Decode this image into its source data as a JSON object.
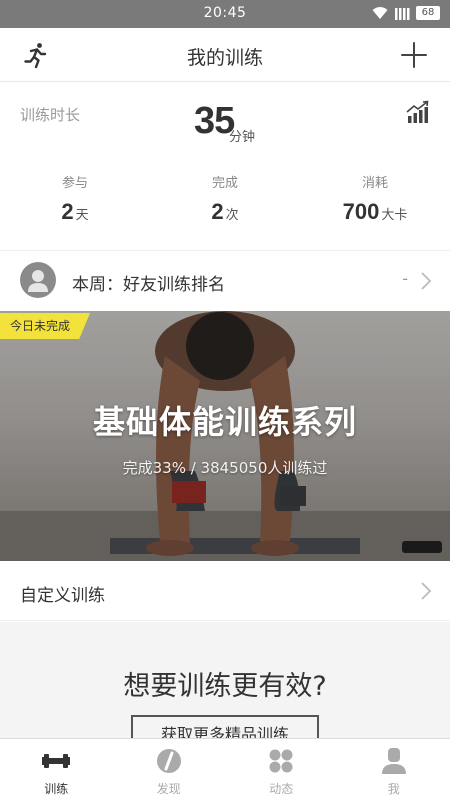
{
  "status_bar": {
    "time": "20:45",
    "battery": "68"
  },
  "header": {
    "title": "我的训练",
    "left_icon": "run-icon",
    "right_icon": "plus-icon"
  },
  "summary": {
    "duration_label": "训练时长",
    "duration_value": "35",
    "duration_unit": "分钟",
    "stats": [
      {
        "label": "参与",
        "value": "2",
        "unit": "天"
      },
      {
        "label": "完成",
        "value": "2",
        "unit": "次"
      },
      {
        "label": "消耗",
        "value": "700",
        "unit": "大卡"
      }
    ]
  },
  "friend_rank": {
    "label": "本周：好友训练排名",
    "value": "-"
  },
  "banner": {
    "badge": "今日未完成",
    "title": "基础体能训练系列",
    "subtitle": "完成33% / 3845050人训练过"
  },
  "custom_training": {
    "label": "自定义训练"
  },
  "promo": {
    "title": "想要训练更有效?",
    "button": "获取更多精品训练"
  },
  "tabs": [
    {
      "label": "训练",
      "icon": "dumbbell-icon",
      "active": true
    },
    {
      "label": "发现",
      "icon": "compass-icon",
      "active": false
    },
    {
      "label": "动态",
      "icon": "grid-dots-icon",
      "active": false
    },
    {
      "label": "我",
      "icon": "person-icon",
      "active": false
    }
  ],
  "colors": {
    "badge": "#f4e23c",
    "status_bar": "#7a7a7a",
    "active_tab": "#333333",
    "inactive_tab": "#aaaaaa"
  }
}
